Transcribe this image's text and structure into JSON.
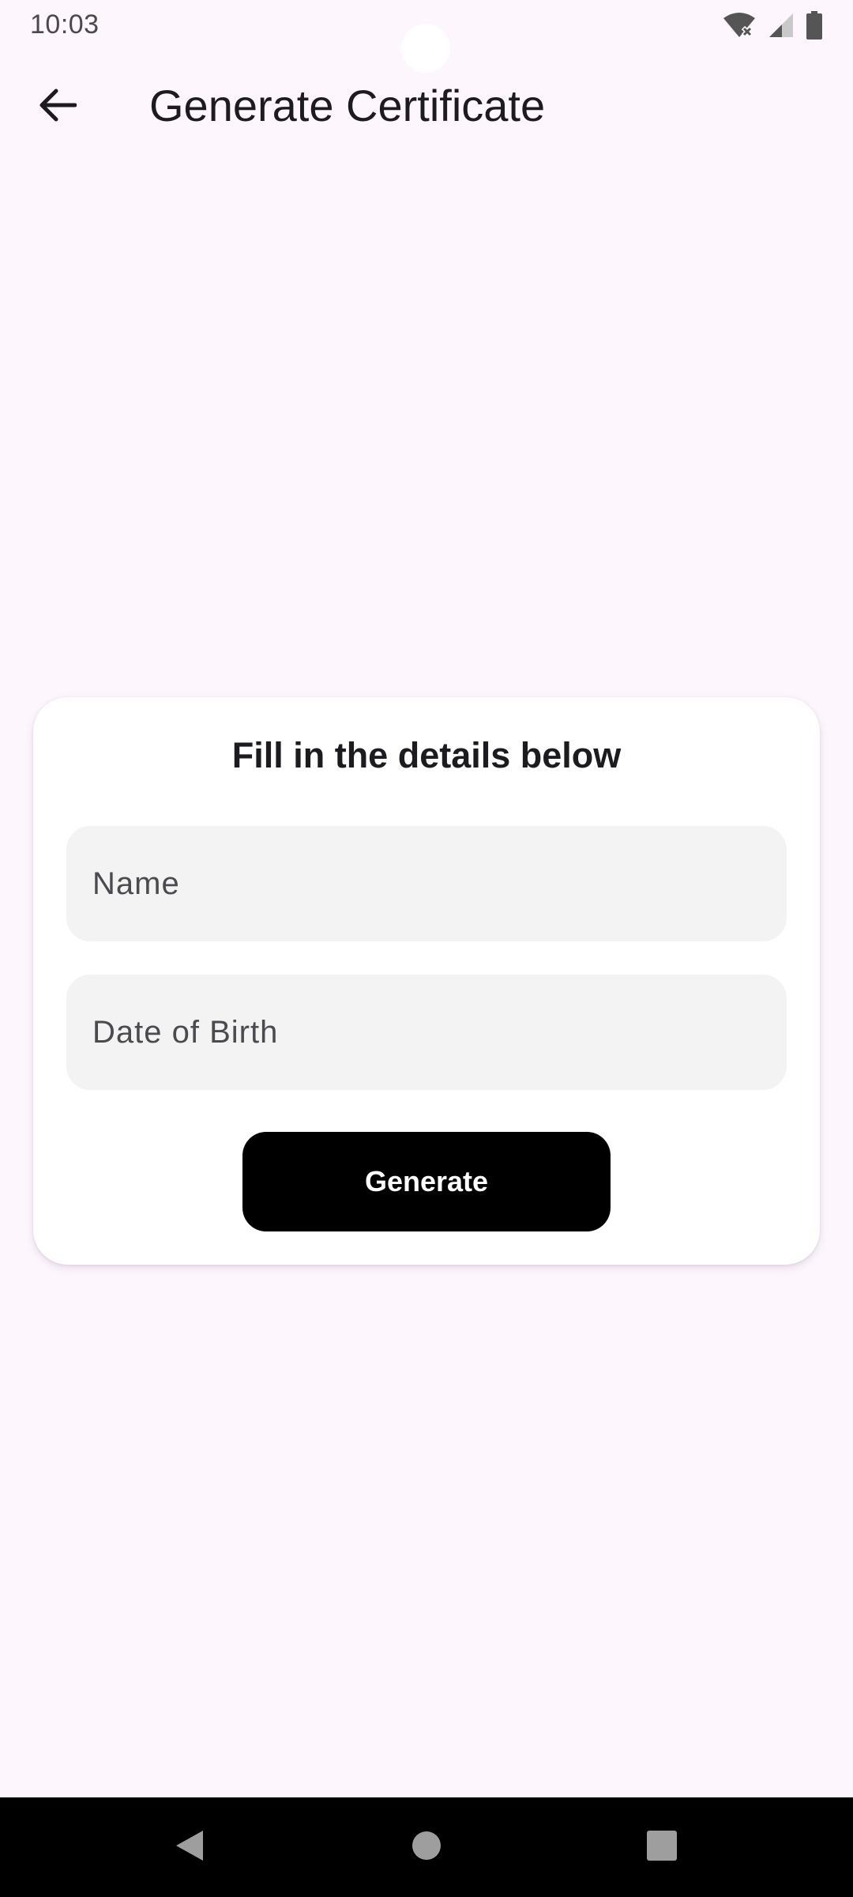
{
  "status_bar": {
    "time": "10:03",
    "icons": [
      "wifi-off-icon",
      "cellular-signal-icon",
      "battery-icon"
    ]
  },
  "app_bar": {
    "back_icon": "arrow-back-icon",
    "title": "Generate Certificate"
  },
  "form": {
    "heading": "Fill in the details below",
    "name_field": {
      "placeholder": "Name",
      "value": ""
    },
    "dob_field": {
      "placeholder": "Date of Birth",
      "value": ""
    },
    "generate_label": "Generate"
  },
  "nav_bar": {
    "buttons": [
      "nav-back-icon",
      "nav-home-icon",
      "nav-recents-icon"
    ]
  },
  "colors": {
    "background": "#fdf6fd",
    "card": "#ffffff",
    "field": "#f3f3f4",
    "button": "#000000",
    "button_text": "#ffffff",
    "text": "#1d1b20"
  }
}
